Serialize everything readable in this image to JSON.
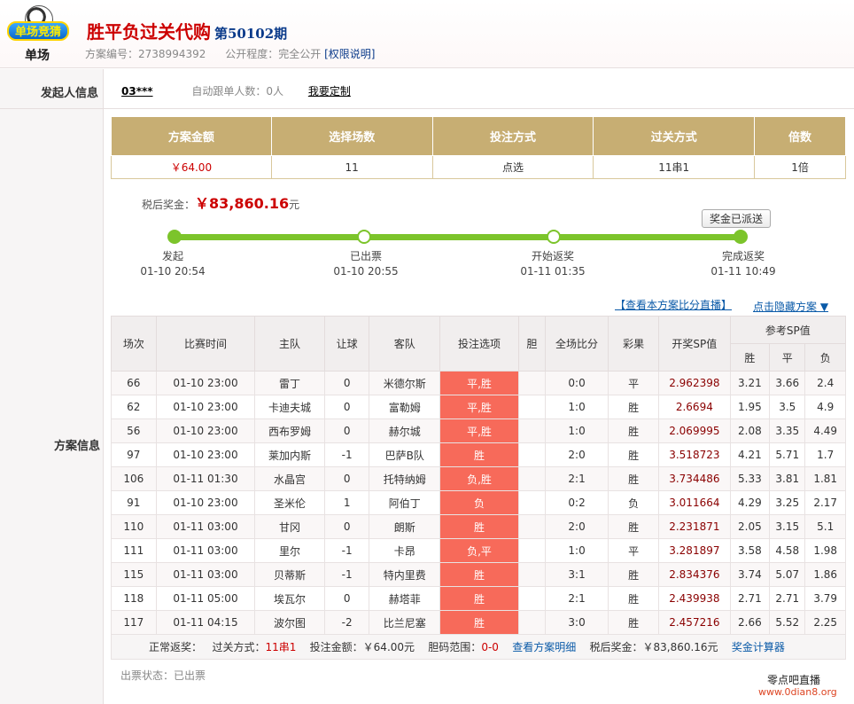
{
  "header": {
    "logo_banner": "单场竞猜",
    "logo_text": "单场",
    "title": "胜平负过关代购",
    "issue": "第50102期",
    "scheme_no_label": "方案编号：",
    "scheme_no": "2738994392",
    "public_label": "公开程度：",
    "public_value": "完全公开",
    "rights_link": "[权限说明]"
  },
  "initiator": {
    "label": "发起人信息",
    "user": "03***",
    "follow": "自动跟单人数：0人",
    "custom": "我要定制"
  },
  "scheme_label": "方案信息",
  "summary": {
    "headers": [
      "方案金额",
      "选择场数",
      "投注方式",
      "过关方式",
      "倍数"
    ],
    "values": [
      "￥64.00",
      "11",
      "点选",
      "11串1",
      "1倍"
    ]
  },
  "prize": {
    "label": "税后奖金：",
    "amount": "￥83,860.16",
    "unit": "元"
  },
  "progress": {
    "sent_button": "奖金已派送",
    "steps": [
      {
        "name": "发起",
        "time": "01-10 20:54"
      },
      {
        "name": "已出票",
        "time": "01-10 20:55"
      },
      {
        "name": "开始返奖",
        "time": "01-11 01:35"
      },
      {
        "name": "完成返奖",
        "time": "01-11 10:49"
      }
    ]
  },
  "links": {
    "live": "【查看本方案比分直播】",
    "hide": "点击隐藏方案 ▼"
  },
  "detail": {
    "headers": {
      "no": "场次",
      "time": "比赛时间",
      "home": "主队",
      "handicap": "让球",
      "away": "客队",
      "pick": "投注选项",
      "dan": "胆",
      "score": "全场比分",
      "result": "彩果",
      "sp": "开奖SP值",
      "ref": "参考SP值",
      "win": "胜",
      "draw": "平",
      "lose": "负"
    },
    "rows": [
      [
        "66",
        "01-10 23:00",
        "雷丁",
        "0",
        "米德尔斯",
        "平,胜",
        "",
        "0:0",
        "平",
        "2.962398",
        "3.21",
        "3.66",
        "2.4"
      ],
      [
        "62",
        "01-10 23:00",
        "卡迪夫城",
        "0",
        "富勒姆",
        "平,胜",
        "",
        "1:0",
        "胜",
        "2.6694",
        "1.95",
        "3.5",
        "4.9"
      ],
      [
        "56",
        "01-10 23:00",
        "西布罗姆",
        "0",
        "赫尔城",
        "平,胜",
        "",
        "1:0",
        "胜",
        "2.069995",
        "2.08",
        "3.35",
        "4.49"
      ],
      [
        "97",
        "01-10 23:00",
        "莱加内斯",
        "-1",
        "巴萨B队",
        "胜",
        "",
        "2:0",
        "胜",
        "3.518723",
        "4.21",
        "5.71",
        "1.7"
      ],
      [
        "106",
        "01-11 01:30",
        "水晶宫",
        "0",
        "托特纳姆",
        "负,胜",
        "",
        "2:1",
        "胜",
        "3.734486",
        "5.33",
        "3.81",
        "1.81"
      ],
      [
        "91",
        "01-10 23:00",
        "圣米伦",
        "1",
        "阿伯丁",
        "负",
        "",
        "0:2",
        "负",
        "3.011664",
        "4.29",
        "3.25",
        "2.17"
      ],
      [
        "110",
        "01-11 03:00",
        "甘冈",
        "0",
        "朗斯",
        "胜",
        "",
        "2:0",
        "胜",
        "2.231871",
        "2.05",
        "3.15",
        "5.1"
      ],
      [
        "111",
        "01-11 03:00",
        "里尔",
        "-1",
        "卡昂",
        "负,平",
        "",
        "1:0",
        "平",
        "3.281897",
        "3.58",
        "4.58",
        "1.98"
      ],
      [
        "115",
        "01-11 03:00",
        "贝蒂斯",
        "-1",
        "特内里费",
        "胜",
        "",
        "3:1",
        "胜",
        "2.834376",
        "3.74",
        "5.07",
        "1.86"
      ],
      [
        "118",
        "01-11 05:00",
        "埃瓦尔",
        "0",
        "赫塔菲",
        "胜",
        "",
        "2:1",
        "胜",
        "2.439938",
        "2.71",
        "2.71",
        "3.79"
      ],
      [
        "117",
        "01-11 04:15",
        "波尔图",
        "-2",
        "比兰尼塞",
        "胜",
        "",
        "3:0",
        "胜",
        "2.457216",
        "2.66",
        "5.52",
        "2.25"
      ]
    ],
    "footer": {
      "normal": "正常返奖：",
      "pass_label": "过关方式：",
      "pass_value": "11串1",
      "bet_label": "投注金额：",
      "bet_value": "￥64.00元",
      "dan_label": "胆码范围：",
      "dan_value": "0-0",
      "detail_link": "查看方案明细",
      "prize_label": "税后奖金：",
      "prize_value": "￥83,860.16元",
      "calc_link": "奖金计算器"
    }
  },
  "ticket_status": "出票状态：已出票",
  "watermark": {
    "line1": "零点吧直播",
    "line2": "www.0dian8.org"
  },
  "colors": {
    "summary_header": "#c7ae73",
    "pick_bg": "#f76a5a",
    "progress": "#7cc42b",
    "title_red": "#cc0000"
  }
}
